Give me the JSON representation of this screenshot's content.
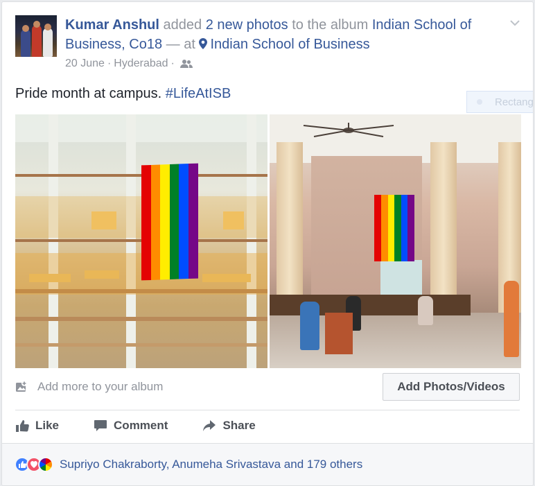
{
  "post": {
    "author": "Kumar Anshul",
    "action_text": "added",
    "photos_count_text": "2 new photos",
    "to_text": "to the album",
    "album_name": "Indian School of Business, Co18",
    "at_text": "— at",
    "location": "Indian School of Business",
    "date": "20 June",
    "separator": "·",
    "city": "Hyderabad",
    "caption_text": "Pride month at campus.",
    "hashtag": "#LifeAtISB",
    "audience_icon": "friends-icon"
  },
  "overlay": {
    "ghost_label": "Rectang"
  },
  "photos": [
    {
      "name": "atrium-photo",
      "flag": "rainbow-flag"
    },
    {
      "name": "lobby-photo",
      "flag": "rainbow-flag"
    }
  ],
  "album": {
    "add_more_text": "Add more to your album",
    "add_button_label": "Add Photos/Videos"
  },
  "actions": {
    "like_label": "Like",
    "comment_label": "Comment",
    "share_label": "Share"
  },
  "reactions": {
    "icons": [
      "like-icon",
      "love-icon",
      "pride-icon"
    ],
    "summary": "Supriyo Chakraborty, Anumeha Srivastava and 179 others"
  },
  "colors": {
    "link": "#365899",
    "muted": "#90949c",
    "rainbow": [
      "#e40303",
      "#ff8c00",
      "#ffed00",
      "#008026",
      "#004dff",
      "#750787"
    ]
  }
}
